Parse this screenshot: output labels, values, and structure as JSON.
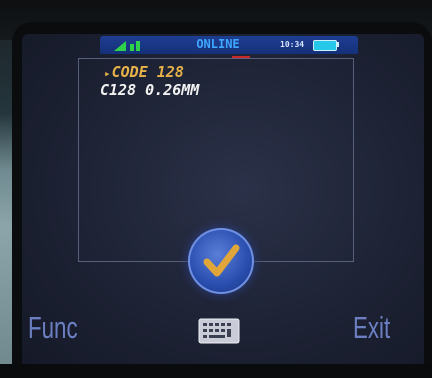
{
  "status_bar": {
    "title": "ONLINE",
    "clock": "10:34",
    "signal_icon": "signal-strength-icon",
    "battery_icon": "battery-icon"
  },
  "barcode_list": {
    "items": [
      {
        "label": "CODE 128",
        "color": "#e8b24a",
        "selected": true
      },
      {
        "label": "C128 0.26MM",
        "color": "#f2f2f2",
        "selected": false
      }
    ]
  },
  "confirm_button": {
    "icon": "checkmark-icon"
  },
  "softkeys": {
    "left_label": "Func",
    "center_icon": "keyboard-icon",
    "right_label": "Exit"
  },
  "colors": {
    "status_bar": "#1e3e92",
    "status_text": "#3fa6ff",
    "softkey_text": "#6b7fc2",
    "selected_item": "#e8b24a",
    "confirm_check": "#e0a63a"
  }
}
